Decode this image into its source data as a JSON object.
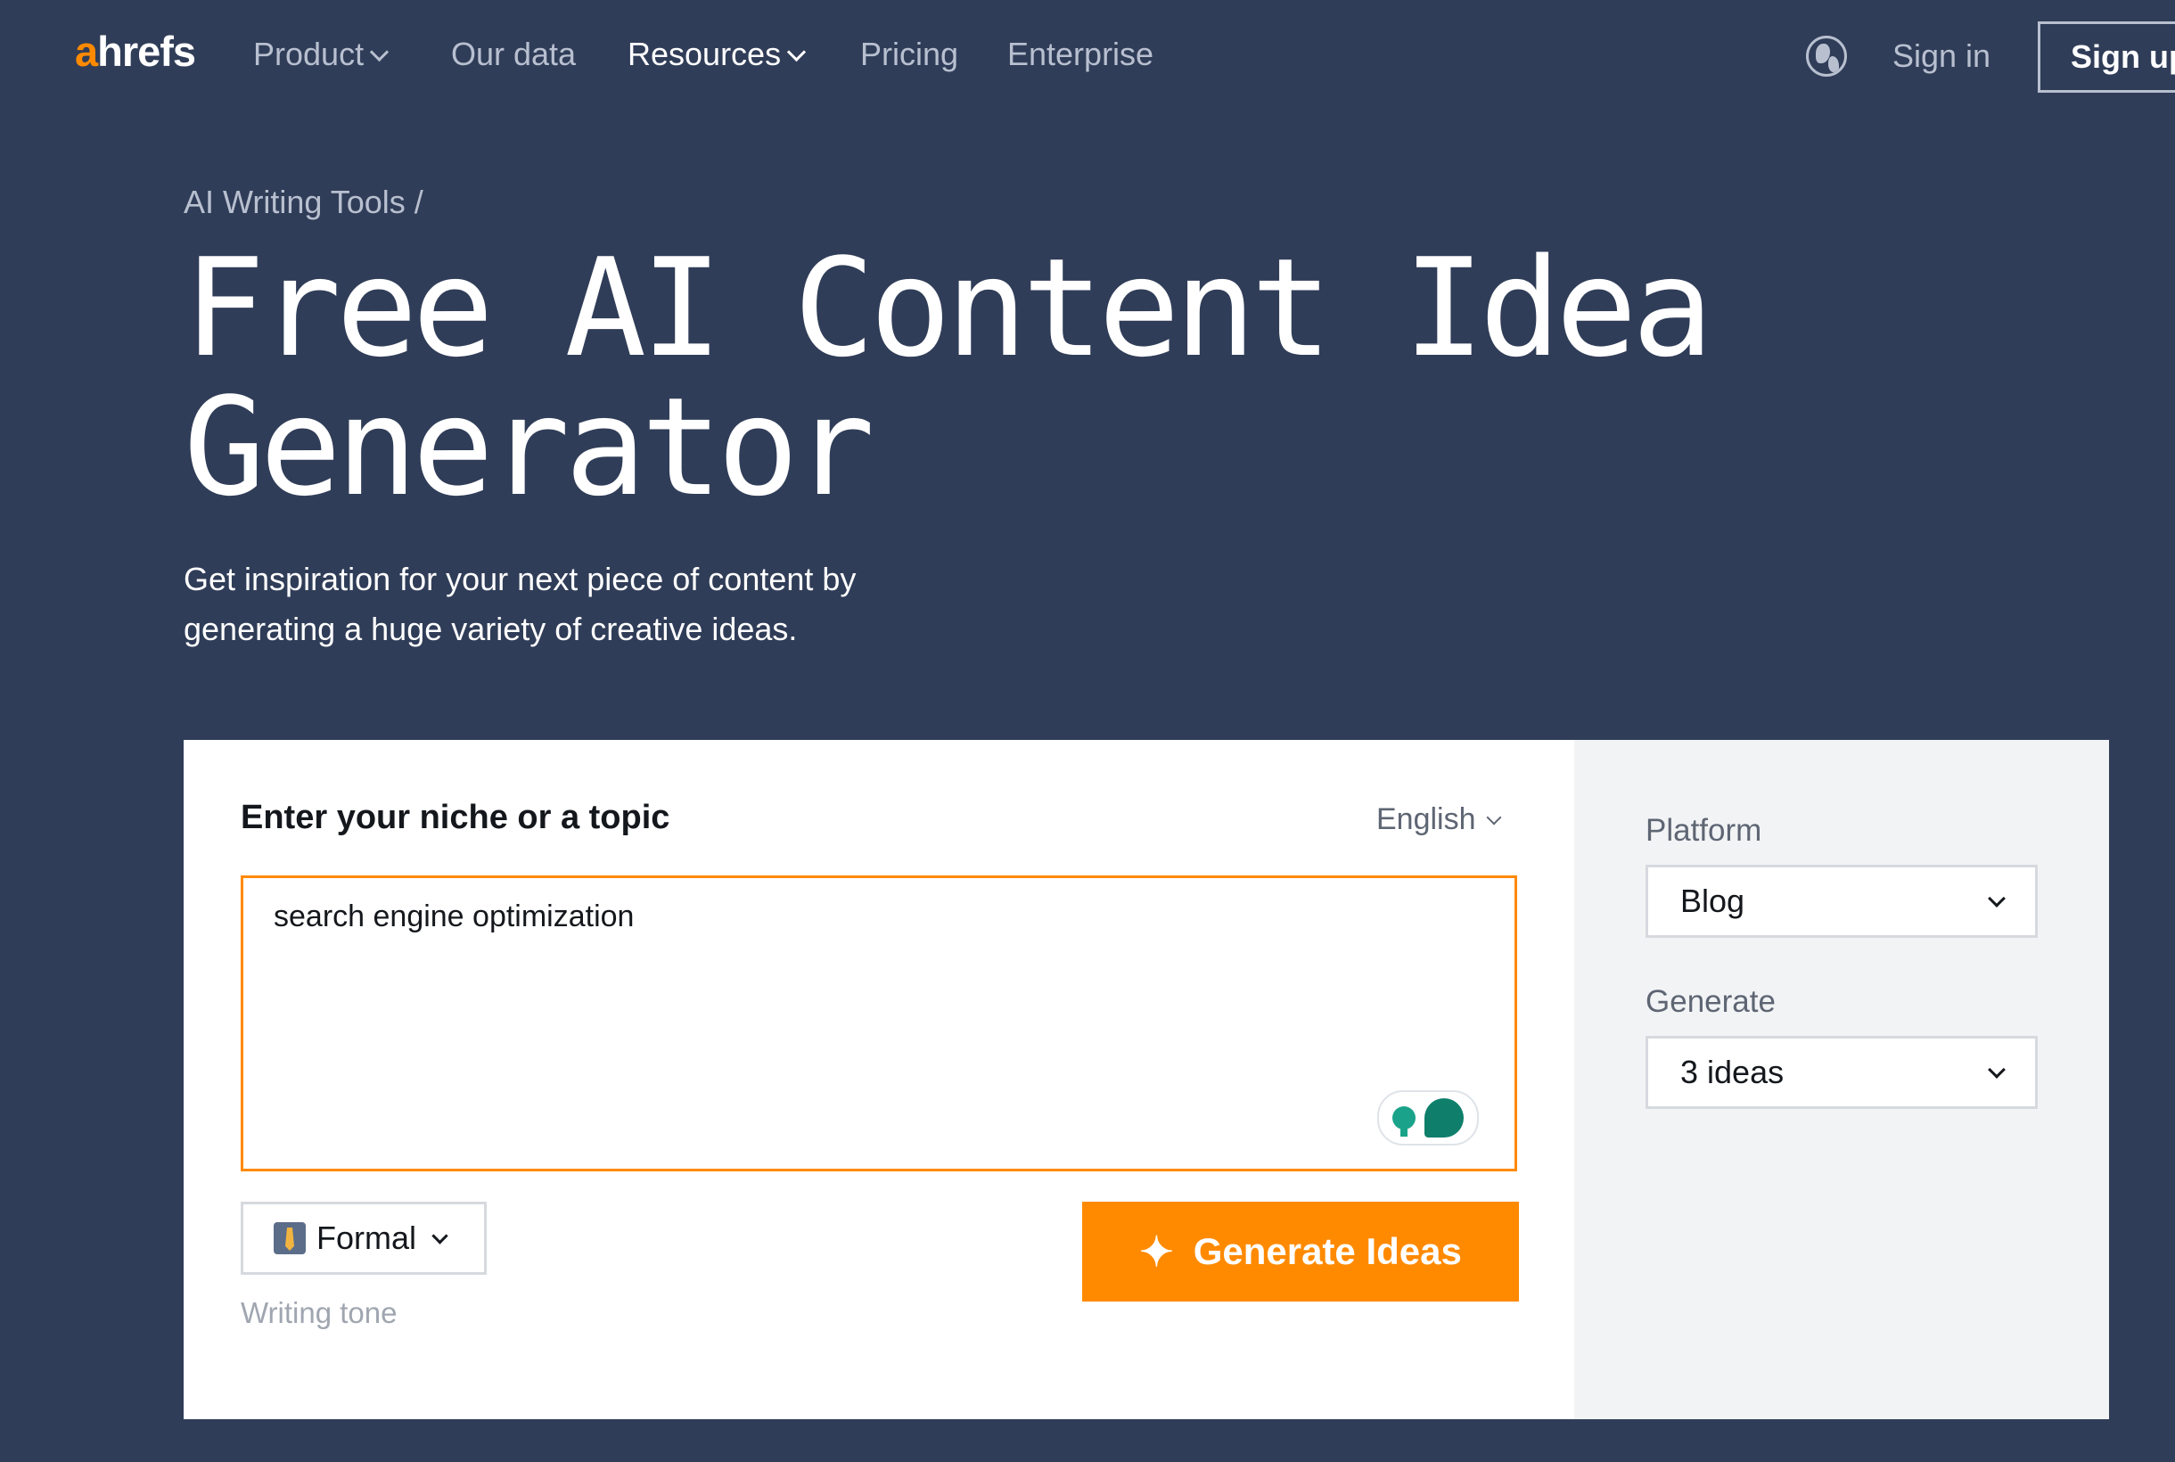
{
  "nav": {
    "logo_accent": "a",
    "logo_rest": "hrefs",
    "items": [
      {
        "label": "Product",
        "dropdown": true
      },
      {
        "label": "Our data",
        "dropdown": false
      },
      {
        "label": "Resources",
        "dropdown": true
      },
      {
        "label": "Pricing",
        "dropdown": false
      },
      {
        "label": "Enterprise",
        "dropdown": false
      }
    ],
    "signin": "Sign in",
    "signup": "Sign up"
  },
  "hero": {
    "breadcrumb": "AI Writing Tools /",
    "title_line1": "Free AI Content Idea",
    "title_line2": "Generator",
    "subtitle": "Get inspiration for your next piece of content by generating a huge variety of creative ideas."
  },
  "form": {
    "label": "Enter your niche or a topic",
    "language": "English",
    "topic_value": "search engine optimization",
    "tone": "Formal",
    "tone_hint": "Writing tone",
    "generate_button": "Generate Ideas",
    "sparkle_glyph": "✦",
    "platform_label": "Platform",
    "platform_value": "Blog",
    "count_label": "Generate",
    "count_value": "3 ideas"
  },
  "colors": {
    "background": "#303d58",
    "accent": "#ff8a00",
    "panel": "#f2f3f5"
  }
}
